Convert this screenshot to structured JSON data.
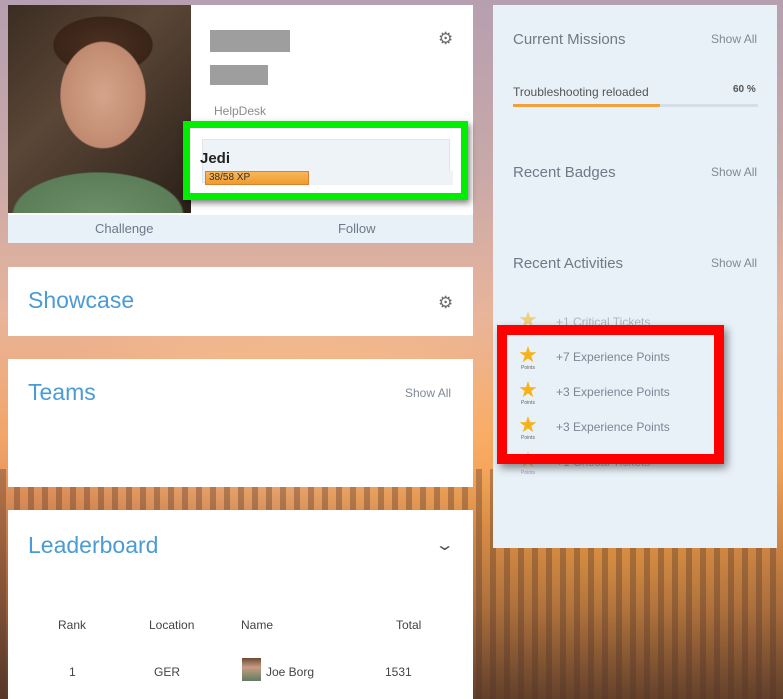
{
  "profile": {
    "department": "HelpDesk",
    "rank": "Jedi",
    "xp_text": "38/58 XP",
    "xp_current": 38,
    "xp_total": 58,
    "challenge_label": "Challenge",
    "follow_label": "Follow"
  },
  "showcase": {
    "title": "Showcase"
  },
  "teams": {
    "title": "Teams",
    "show_all": "Show All"
  },
  "leaderboard": {
    "title": "Leaderboard",
    "columns": [
      "Rank",
      "Location",
      "Name",
      "Total"
    ],
    "rows": [
      {
        "rank": "1",
        "location": "GER",
        "name": "Joe Borg",
        "total": "1531"
      }
    ]
  },
  "right": {
    "missions_title": "Current Missions",
    "missions_show_all": "Show All",
    "mission": {
      "label": "Troubleshooting reloaded",
      "percent_text": "60 %",
      "progress": 0.6
    },
    "badges_title": "Recent Badges",
    "badges_show_all": "Show All",
    "activities_title": "Recent Activities",
    "activities_show_all": "Show All",
    "activities": [
      {
        "text": "+1 Critical Tickets",
        "icon_caption": ""
      },
      {
        "text": "+7 Experience Points",
        "icon_caption": "Points"
      },
      {
        "text": "+3 Experience Points",
        "icon_caption": "Points"
      },
      {
        "text": "+3 Experience Points",
        "icon_caption": "Points"
      },
      {
        "text": "+1 Critical Tickets",
        "icon_caption": "Points"
      }
    ]
  },
  "colors": {
    "accent_blue": "#4a9bd6",
    "highlight_green": "#00ee00",
    "highlight_red": "#ff0000",
    "progress_orange": "#f2a03a",
    "star_gold": "#f5b318"
  },
  "icons": {
    "settings": "gear-icon",
    "collapse": "chevron-down-icon",
    "activity": "star-icon"
  }
}
